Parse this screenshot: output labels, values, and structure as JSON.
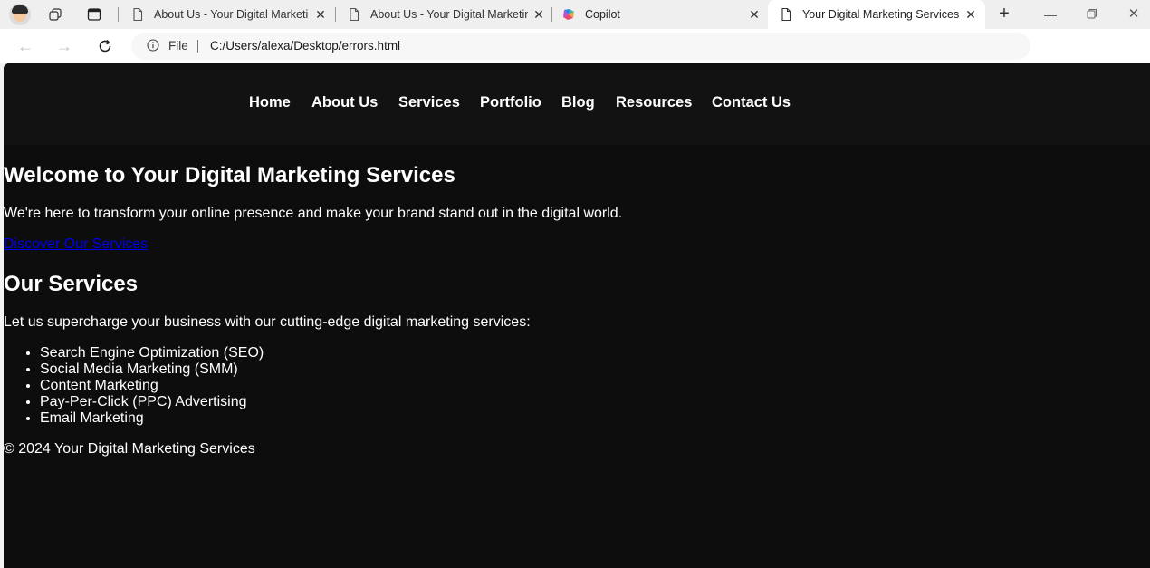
{
  "browser": {
    "tabs": [
      {
        "title": "About Us - Your Digital Marketing Services",
        "favicon": "page-icon"
      },
      {
        "title": "About Us - Your Digital Marketing Services",
        "favicon": "page-icon"
      },
      {
        "title": "Copilot",
        "favicon": "copilot-icon"
      },
      {
        "title": "Your Digital Marketing Services",
        "favicon": "page-icon",
        "active": true
      }
    ],
    "address": {
      "scheme_label": "File",
      "url": "C:/Users/alexa/Desktop/errors.html"
    }
  },
  "page": {
    "nav": [
      "Home",
      "About Us",
      "Services",
      "Portfolio",
      "Blog",
      "Resources",
      "Contact Us"
    ],
    "hero": {
      "heading": "Welcome to Your Digital Marketing Services",
      "text": "We're here to transform your online presence and make your brand stand out in the digital world.",
      "cta": "Discover Our Services"
    },
    "services": {
      "heading": "Our Services",
      "lead": "Let us supercharge your business with our cutting-edge digital marketing services:",
      "items": [
        "Search Engine Optimization (SEO)",
        "Social Media Marketing (SMM)",
        "Content Marketing",
        "Pay-Per-Click (PPC) Advertising",
        "Email Marketing"
      ]
    },
    "footer": "© 2024 Your Digital Marketing Services"
  },
  "colors": {
    "page_bg": "#0d0d0d",
    "header_bg": "#121212",
    "link": "#0000ee"
  }
}
